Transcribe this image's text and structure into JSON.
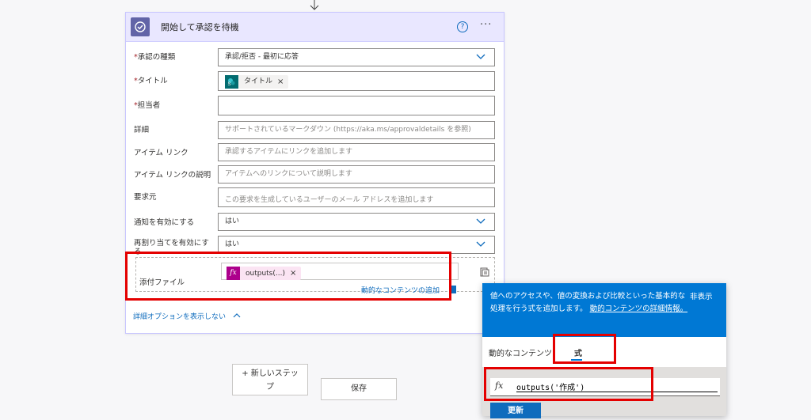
{
  "card": {
    "title": "開始して承認を待機",
    "help": "?",
    "more": "···"
  },
  "fields": {
    "approval_type": {
      "label": "承認の種類",
      "value": "承認/拒否 - 最初に応答"
    },
    "title": {
      "label": "タイトル",
      "token": "タイトル"
    },
    "assigned_to": {
      "label": "担当者",
      "value": ""
    },
    "details": {
      "label": "詳細",
      "placeholder": "サポートされているマークダウン (https://aka.ms/approvaldetails を参照)"
    },
    "item_link": {
      "label": "アイテム リンク",
      "placeholder": "承認するアイテムにリンクを追加します"
    },
    "item_link_desc": {
      "label": "アイテム リンクの説明",
      "placeholder": "アイテムへのリンクについて説明します"
    },
    "requestor": {
      "label": "要求元",
      "placeholder": "この要求を生成しているユーザーのメール アドレスを追加します"
    },
    "enable_notifications": {
      "label": "通知を有効にする",
      "value": "はい"
    },
    "enable_reassignment": {
      "label_line1": "再割り当てを有効にす",
      "label_line2": "る",
      "value": "はい"
    },
    "attachments": {
      "label": "添付ファイル",
      "token": "outputs(...)"
    }
  },
  "required_marker": "*",
  "token_close": "×",
  "dynamic_content_link": "動的なコンテンツの追加",
  "hide_advanced": "詳細オプションを表示しない",
  "buttons": {
    "new_step_line1": "+ 新しいステッ",
    "new_step_line2": "プ",
    "save": "保存"
  },
  "popup": {
    "description": "値へのアクセスや、値の変換および比較といった基本的な処理を行う式を追加します。",
    "description_link": "動的コンテンツの詳細情報。",
    "hide": "非表示",
    "tab_dynamic": "動的なコンテンツ",
    "tab_expression": "式",
    "fx": "fx",
    "expression": "outputs('作成')",
    "update": "更新"
  },
  "colors": {
    "accent": "#0078d4",
    "header": "#e9e7ff",
    "highlight": "#e40000",
    "token_fx": "#ad008c",
    "token_sp": "#036c70"
  }
}
